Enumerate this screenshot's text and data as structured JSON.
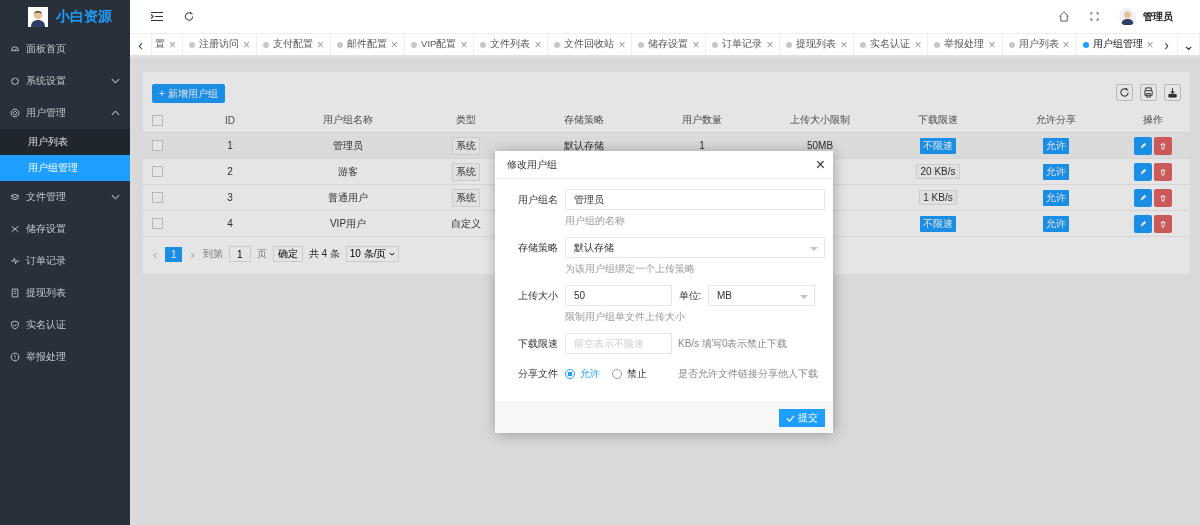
{
  "sidebar": {
    "logo": "小白资源",
    "items": [
      {
        "label": "面板首页"
      },
      {
        "label": "系统设置",
        "expanded": false
      },
      {
        "label": "用户管理",
        "expanded": true,
        "children": [
          {
            "label": "用户列表",
            "selected": false
          },
          {
            "label": "用户组管理",
            "selected": true
          }
        ]
      },
      {
        "label": "文件管理",
        "expanded": false
      },
      {
        "label": "储存设置"
      },
      {
        "label": "订单记录"
      },
      {
        "label": "提现列表"
      },
      {
        "label": "实名认证"
      },
      {
        "label": "举报处理"
      }
    ]
  },
  "header": {
    "user": "管理员"
  },
  "tabs": {
    "prev": "‹",
    "next": "›",
    "more": "⌄",
    "close": "×",
    "items": [
      {
        "label": "置",
        "selected": false
      },
      {
        "label": "注册访问",
        "selected": false
      },
      {
        "label": "支付配置",
        "selected": false
      },
      {
        "label": "邮件配置",
        "selected": false
      },
      {
        "label": "VIP配置",
        "selected": false
      },
      {
        "label": "文件列表",
        "selected": false
      },
      {
        "label": "文件回收站",
        "selected": false
      },
      {
        "label": "储存设置",
        "selected": false
      },
      {
        "label": "订单记录",
        "selected": false
      },
      {
        "label": "提现列表",
        "selected": false
      },
      {
        "label": "实名认证",
        "selected": false
      },
      {
        "label": "举报处理",
        "selected": false
      },
      {
        "label": "用户列表",
        "selected": false
      },
      {
        "label": "用户组管理",
        "selected": true
      }
    ]
  },
  "toolbar": {
    "add_button": "+ 新增用户组"
  },
  "table": {
    "select_all": {
      "checked": false
    },
    "columns": [
      "ID",
      "用户组名称",
      "类型",
      "存储策略",
      "用户数量",
      "上传大小限制",
      "下载限速",
      "允许分享",
      "操作"
    ],
    "rows": [
      {
        "checked": false,
        "id": "1",
        "name": "管理员",
        "type": {
          "text": "系统",
          "kind": "tag"
        },
        "storage": "默认存储",
        "users": "1",
        "upload": "50MB",
        "download": {
          "text": "不限速",
          "kind": "badge"
        },
        "share": "允许"
      },
      {
        "checked": false,
        "id": "2",
        "name": "游客",
        "type": {
          "text": "系统",
          "kind": "tag"
        },
        "download": {
          "text": "20 KB/s",
          "kind": "tag"
        },
        "share": "允许"
      },
      {
        "checked": false,
        "id": "3",
        "name": "普通用户",
        "type": {
          "text": "系统",
          "kind": "tag"
        },
        "download": {
          "text": "1 KB/s",
          "kind": "tag"
        },
        "share": "允许"
      },
      {
        "checked": false,
        "id": "4",
        "name": "VIP用户",
        "type": {
          "text": "自定义",
          "kind": "plain"
        },
        "download": {
          "text": "不限速",
          "kind": "badge"
        },
        "share": "允许"
      }
    ]
  },
  "pagination": {
    "prev": "‹",
    "next": "›",
    "pages": [
      {
        "label": "1",
        "selected": true
      }
    ],
    "goto": "到第",
    "page_value": "1",
    "page_unit": "页",
    "confirm": "确定",
    "total": "共 4 条",
    "per_page": "10 条/页"
  },
  "dialog": {
    "title": "修改用户组",
    "close": "×",
    "name_label": "用户组名",
    "name_value": "管理员",
    "name_hint": "用户组的名称",
    "storage_label": "存储策略",
    "storage_value": "默认存储",
    "storage_hint": "为该用户组绑定一个上传策略",
    "upload_label": "上传大小",
    "upload_value": "50",
    "unit_label": "单位:",
    "unit_value": "MB",
    "upload_hint": "限制用户组单文件上传大小",
    "speed_label": "下载限速",
    "speed_placeholder": "留空表示不限速",
    "speed_hint": "KB/s 填写0表示禁止下载",
    "share_label": "分享文件",
    "share_options": [
      {
        "label": "允许",
        "selected": true
      },
      {
        "label": "禁止",
        "selected": false
      }
    ],
    "share_hint": "是否允许文件链接分享他人下载",
    "submit": "提交"
  }
}
